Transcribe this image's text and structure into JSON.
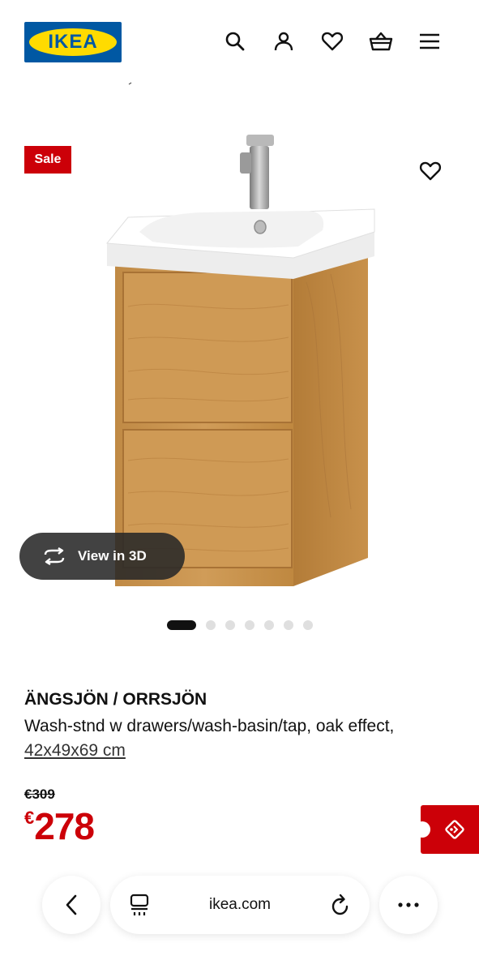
{
  "header": {
    "logo_text": "IKEA",
    "icons": [
      "search-icon",
      "user-icon",
      "heart-icon",
      "basket-icon",
      "menu-icon"
    ]
  },
  "gallery": {
    "sale_badge": "Sale",
    "view3d_label": "View in 3D",
    "image_count": 7,
    "active_image": 1
  },
  "product": {
    "name": "ÄNGSJÖN / ORRSJÖN",
    "description": "Wash-stnd w drawers/wash-basin/tap, oak effect, ",
    "dimensions": "42x49x69 cm",
    "old_price": "€309",
    "price_currency": "€",
    "price_amount": "278"
  },
  "browser": {
    "domain": "ikea.com"
  },
  "colors": {
    "ikea_blue": "#0058a3",
    "ikea_yellow": "#ffdb00",
    "sale_red": "#cc0008",
    "wood": "#c89450"
  }
}
